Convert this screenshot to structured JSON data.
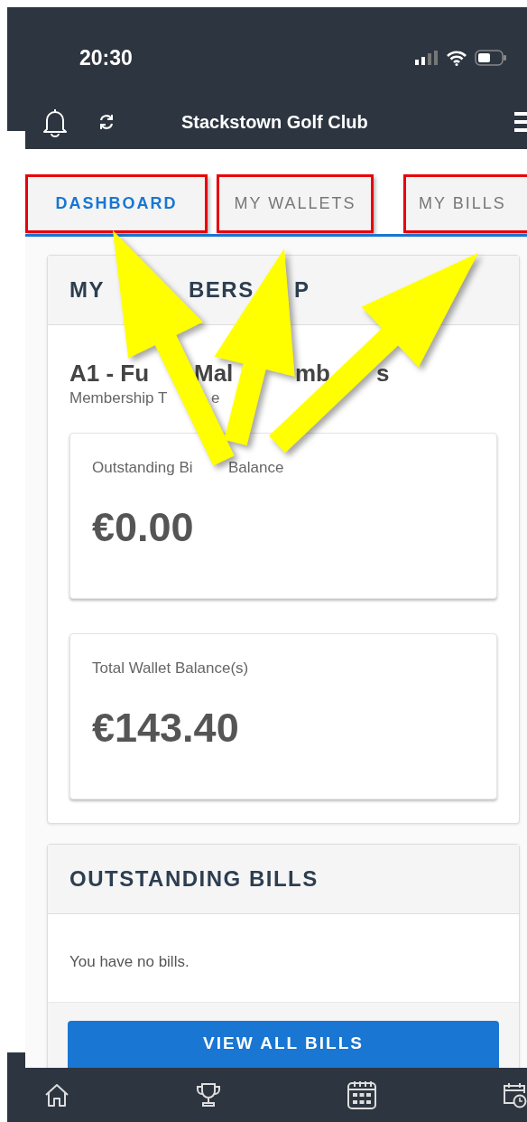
{
  "status_bar": {
    "time": "20:30"
  },
  "nav_bar": {
    "title": "Stackstown Golf Club"
  },
  "tabs": [
    {
      "label": "DASHBOARD",
      "selected": true
    },
    {
      "label": "MY WALLETS",
      "selected": false
    },
    {
      "label": "MY BILLS",
      "selected": false
    }
  ],
  "membership": {
    "heading": [
      "MY",
      "BERS",
      "P"
    ],
    "type_name": [
      "A1 - Fu",
      "Mal",
      "mb",
      "s"
    ],
    "type_label": [
      "Membership T",
      "e"
    ],
    "balances": [
      {
        "label": [
          "Outstanding Bi",
          "Balance"
        ],
        "amount": "€0.00"
      },
      {
        "label": [
          "Total Wallet Balance(s)"
        ],
        "amount": "€143.40"
      }
    ]
  },
  "bills": {
    "heading": "OUTSTANDING BILLS",
    "message": "You have no bills.",
    "button": "VIEW ALL BILLS"
  }
}
